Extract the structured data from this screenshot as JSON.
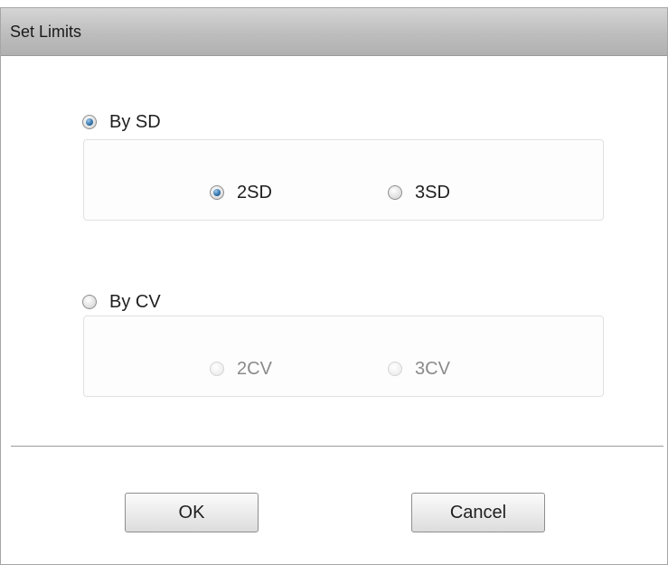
{
  "dialog": {
    "title": "Set Limits"
  },
  "by_sd": {
    "label": "By SD",
    "selected": true,
    "options": [
      {
        "label": "2SD",
        "selected": true
      },
      {
        "label": "3SD",
        "selected": false
      }
    ]
  },
  "by_cv": {
    "label": "By CV",
    "selected": false,
    "options": [
      {
        "label": "2CV",
        "selected": false,
        "enabled": false
      },
      {
        "label": "3CV",
        "selected": false,
        "enabled": false
      }
    ]
  },
  "buttons": {
    "ok_label": "OK",
    "cancel_label": "Cancel"
  },
  "colors": {
    "accent_radio": "#2c6fa8",
    "titlebar": "#bdbdbd"
  }
}
